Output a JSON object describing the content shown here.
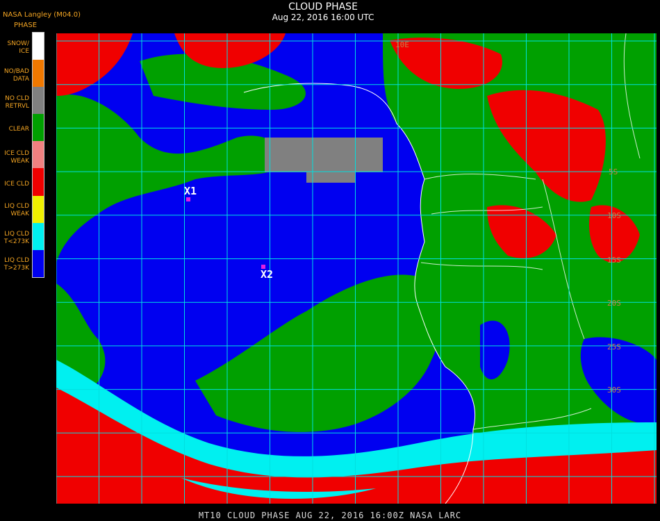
{
  "header": {
    "title": "CLOUD PHASE",
    "subtitle": "Aug 22, 2016 16:00 UTC",
    "brand": "NASA Langley (M04.0)",
    "legend_title": "PHASE"
  },
  "legend": [
    {
      "label": "SNOW/\nICE",
      "color": "#ffffff"
    },
    {
      "label": "NO/BAD\nDATA",
      "color": "#f07800"
    },
    {
      "label": "NO CLD\nRETRVL",
      "color": "#808080"
    },
    {
      "label": "CLEAR",
      "color": "#00a000"
    },
    {
      "label": "ICE CLD\nWEAK",
      "color": "#f08080"
    },
    {
      "label": "ICE CLD",
      "color": "#f00000"
    },
    {
      "label": "LIQ CLD\nWEAK",
      "color": "#f0f000"
    },
    {
      "label": "LIQ CLD\nT<273K",
      "color": "#00f0f0"
    },
    {
      "label": "LIQ CLD\nT>273K",
      "color": "#0000f0"
    }
  ],
  "map": {
    "lat_labels": [
      "5S",
      "10S",
      "15S",
      "20S",
      "25S",
      "30S"
    ],
    "lon_labels": [
      "10E"
    ],
    "markers": [
      {
        "label": "X1"
      },
      {
        "label": "X2"
      }
    ],
    "grid_color": "#00e0e0"
  },
  "footer": "MT10  CLOUD PHASE   AUG 22, 2016 16:00Z   NASA LARC"
}
